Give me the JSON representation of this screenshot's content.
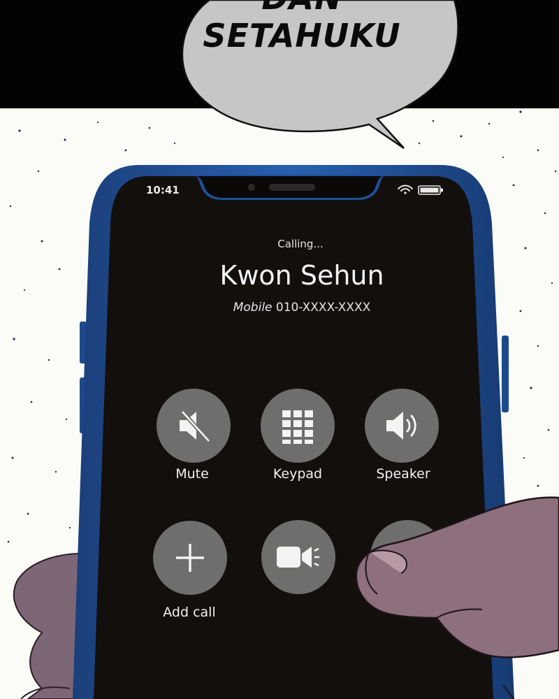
{
  "speech_bubble": {
    "line1": "DAN",
    "line2": "SETAHUKU"
  },
  "status_bar": {
    "time": "10:41",
    "icons": [
      "wifi-icon",
      "battery-icon"
    ]
  },
  "call": {
    "status": "Calling...",
    "caller_name": "Kwon Sehun",
    "number_label": "Mobile",
    "number": "010-XXXX-XXXX"
  },
  "controls": [
    {
      "label": "Mute",
      "icon": "mute-icon"
    },
    {
      "label": "Keypad",
      "icon": "keypad-icon"
    },
    {
      "label": "Speaker",
      "icon": "speaker-icon"
    },
    {
      "label": "Add call",
      "icon": "plus-icon"
    },
    {
      "label": "",
      "icon": "video-camera-icon"
    },
    {
      "label": "",
      "icon": "contacts-icon"
    }
  ],
  "colors": {
    "panel_background": "#fbfbf8",
    "top_band": "#030303",
    "speech_bubble": "#c6c6c6",
    "phone_frame": "#1f4f96",
    "phone_screen": "#130f0d",
    "control_button": "#6e6e6d",
    "skin": "#8d6f7e"
  }
}
